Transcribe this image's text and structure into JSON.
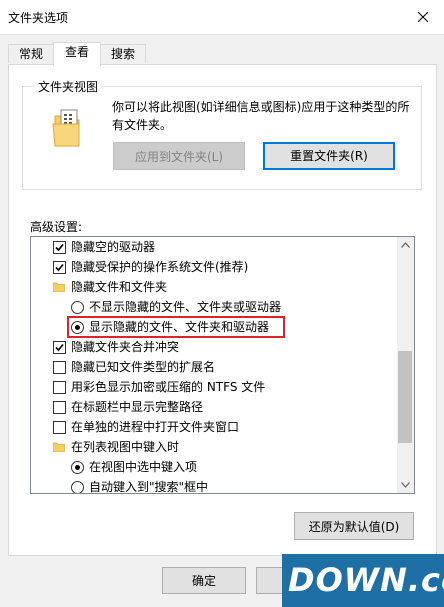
{
  "window": {
    "title": "文件夹选项"
  },
  "tabs": [
    {
      "label": "常规"
    },
    {
      "label": "查看"
    },
    {
      "label": "搜索"
    }
  ],
  "folder_views": {
    "legend": "文件夹视图",
    "description": "你可以将此视图(如详细信息或图标)应用于这种类型的所有文件夹。",
    "apply_button": "应用到文件夹(L)",
    "reset_button": "重置文件夹(R)"
  },
  "advanced": {
    "label": "高级设置:",
    "items": [
      {
        "type": "checkbox",
        "checked": true,
        "label": "隐藏空的驱动器"
      },
      {
        "type": "checkbox",
        "checked": true,
        "label": "隐藏受保护的操作系统文件(推荐)"
      },
      {
        "type": "folder",
        "label": "隐藏文件和文件夹"
      },
      {
        "type": "radio",
        "selected": false,
        "label": "不显示隐藏的文件、文件夹或驱动器"
      },
      {
        "type": "radio",
        "selected": true,
        "label": "显示隐藏的文件、文件夹和驱动器"
      },
      {
        "type": "checkbox",
        "checked": true,
        "label": "隐藏文件夹合并冲突"
      },
      {
        "type": "checkbox",
        "checked": false,
        "label": "隐藏已知文件类型的扩展名"
      },
      {
        "type": "checkbox",
        "checked": false,
        "label": "用彩色显示加密或压缩的 NTFS 文件"
      },
      {
        "type": "checkbox",
        "checked": false,
        "label": "在标题栏中显示完整路径"
      },
      {
        "type": "checkbox",
        "checked": false,
        "label": "在单独的进程中打开文件夹窗口"
      },
      {
        "type": "folder",
        "label": "在列表视图中键入时"
      },
      {
        "type": "radio",
        "selected": true,
        "label": "在视图中选中键入项"
      },
      {
        "type": "radio",
        "selected": false,
        "label": "自动键入到\"搜索\"框中"
      }
    ],
    "restore_button": "还原为默认值(D)"
  },
  "footer": {
    "ok_button": "确定"
  },
  "watermark": {
    "text": "DOWN.cc"
  },
  "colors": {
    "highlight": "#d9262a",
    "focus": "#0078d7",
    "watermark": "#1d6fa5"
  }
}
